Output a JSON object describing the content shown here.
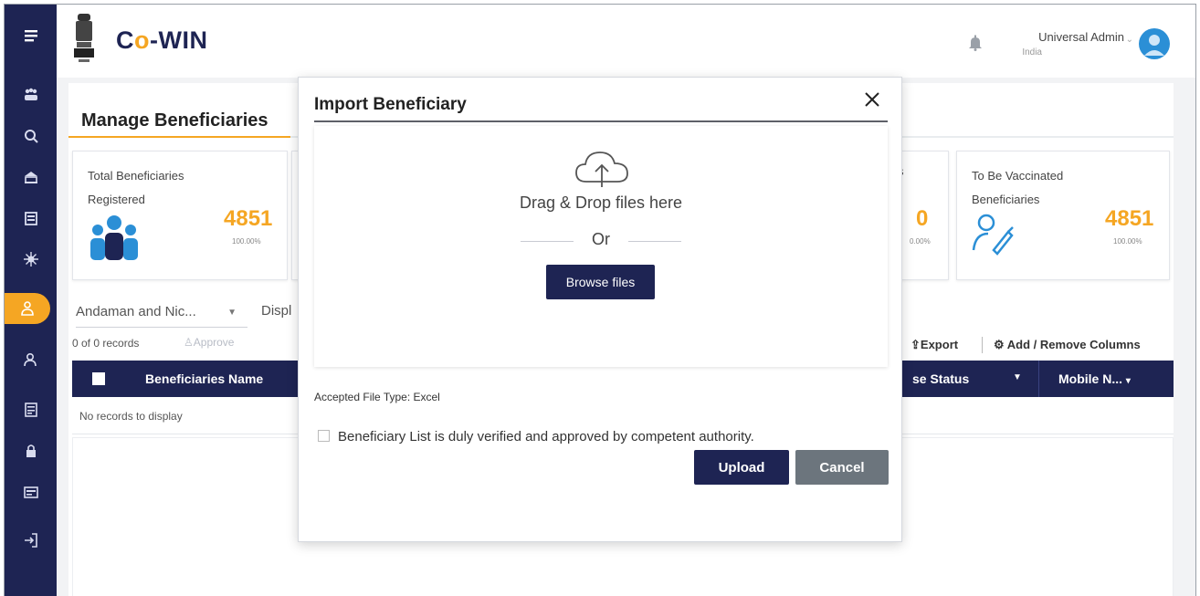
{
  "header": {
    "brand_prefix": "C",
    "brand_dot": "o",
    "brand_suffix": "-WIN",
    "user_name": "Universal Admin",
    "user_country": "India"
  },
  "page": {
    "title": "Manage Beneficiaries"
  },
  "stats": {
    "total": {
      "label_line1": "Total Beneficiaries",
      "label_line2": "Registered",
      "value": "4851",
      "percent": "100.00%"
    },
    "middle": {
      "label_fragment": "s",
      "value": "0",
      "percent": "0.00%"
    },
    "to_be_vaccinated": {
      "label_line1": "To Be Vaccinated",
      "label_line2": "Beneficiaries",
      "value": "4851",
      "percent": "100.00%"
    }
  },
  "filters": {
    "state_selected": "Andaman and Nic...",
    "display_fragment": "Displ"
  },
  "toolbar": {
    "records_count": "0 of 0 records",
    "approve_label": "Approve",
    "export_label": "Export",
    "add_remove_columns_label": "Add / Remove Columns"
  },
  "table": {
    "columns": [
      "Beneficiaries Name",
      "se Status",
      "Mobile N..."
    ],
    "empty_message": "No records to display"
  },
  "modal": {
    "title": "Import Beneficiary",
    "drag_text": "Drag & Drop files here",
    "or_text": "Or",
    "browse_label": "Browse files",
    "accepted_types": "Accepted File Type: Excel",
    "consent_text": "Beneficiary List is duly verified and approved by competent authority.",
    "upload_label": "Upload",
    "cancel_label": "Cancel"
  },
  "colors": {
    "navy": "#1e2453",
    "accent_orange": "#f5a623",
    "cancel_gray": "#6c757d"
  },
  "icons": {
    "sidebar": [
      "menu-icon",
      "dashboard-icon",
      "vaccine-icon",
      "center-icon",
      "session-icon",
      "virus-icon",
      "beneficiaries-icon",
      "user-icon",
      "report-icon",
      "lock-icon",
      "card-icon",
      "logout-icon"
    ]
  }
}
